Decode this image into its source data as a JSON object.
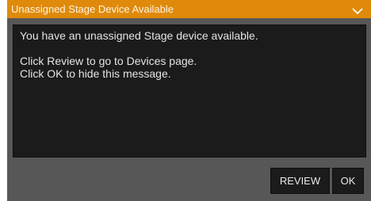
{
  "dialog": {
    "title": "Unassigned Stage Device Available",
    "collapse_icon": "chevron-down-icon",
    "message": {
      "line1": "You have an unassigned Stage device available.",
      "line2": "Click Review to go to Devices page.",
      "line3": "Click OK to hide this message."
    },
    "buttons": {
      "review_label": "REVIEW",
      "ok_label": "OK"
    }
  },
  "colors": {
    "titlebar": "#e08a0c",
    "dialog_background": "#575757",
    "panel_background": "#1b1b1b",
    "text": "#e4e4e4"
  }
}
